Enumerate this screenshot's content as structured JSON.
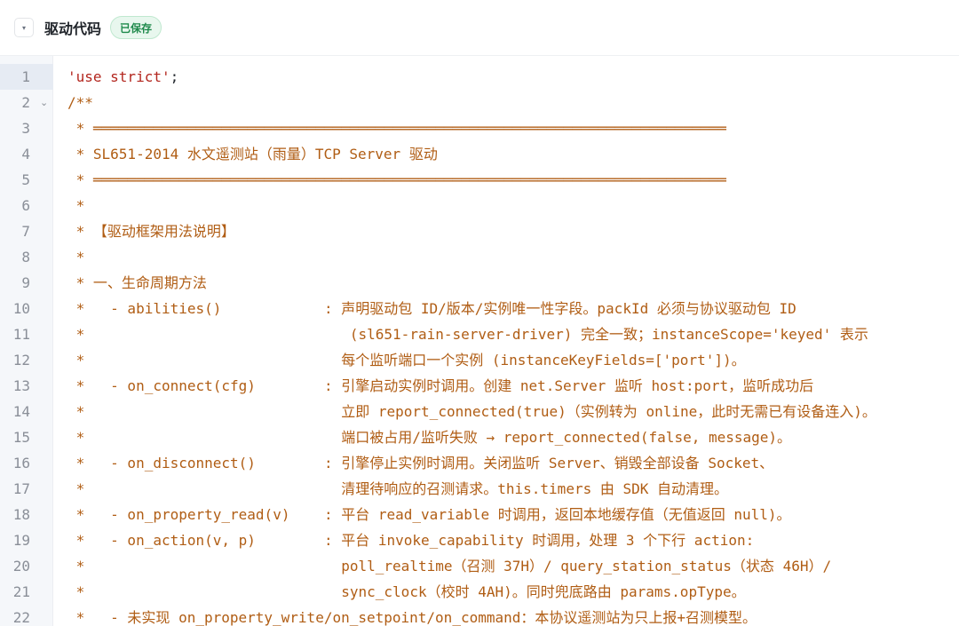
{
  "header": {
    "collapse_glyph": "▾",
    "title": "驱动代码",
    "status_badge": "已保存"
  },
  "colors": {
    "comment": "#b05d14",
    "string": "#b3261e",
    "line_number": "#8a8f98",
    "gutter_bg": "#f5f7fa",
    "active_line_bg": "#e6ebf3",
    "badge_bg": "#e8f7ee",
    "badge_text": "#1f8a4c"
  },
  "editor": {
    "active_line": 1,
    "fold_marker_line": 2,
    "fold_icon": "chevron-down-icon",
    "line1": {
      "string": "'use strict'",
      "punct": ";"
    },
    "lines": [
      {
        "num": "1",
        "text": ""
      },
      {
        "num": "2",
        "text": "/**"
      },
      {
        "num": "3",
        "text": " * ══════════════════════════════════════════════════════════════════════════"
      },
      {
        "num": "4",
        "text": " * SL651-2014 水文遥测站（雨量）TCP Server 驱动"
      },
      {
        "num": "5",
        "text": " * ══════════════════════════════════════════════════════════════════════════"
      },
      {
        "num": "6",
        "text": " *"
      },
      {
        "num": "7",
        "text": " * 【驱动框架用法说明】"
      },
      {
        "num": "8",
        "text": " *"
      },
      {
        "num": "9",
        "text": " * 一、生命周期方法"
      },
      {
        "num": "10",
        "text": " *   - abilities()            : 声明驱动包 ID/版本/实例唯一性字段。packId 必须与协议驱动包 ID"
      },
      {
        "num": "11",
        "text": " *                               (sl651-rain-server-driver) 完全一致；instanceScope='keyed' 表示"
      },
      {
        "num": "12",
        "text": " *                              每个监听端口一个实例 (instanceKeyFields=['port'])。"
      },
      {
        "num": "13",
        "text": " *   - on_connect(cfg)        : 引擎启动实例时调用。创建 net.Server 监听 host:port，监听成功后"
      },
      {
        "num": "14",
        "text": " *                              立即 report_connected(true)（实例转为 online，此时无需已有设备连入)。"
      },
      {
        "num": "15",
        "text": " *                              端口被占用/监听失败 → report_connected(false, message)。"
      },
      {
        "num": "16",
        "text": " *   - on_disconnect()        : 引擎停止实例时调用。关闭监听 Server、销毁全部设备 Socket、"
      },
      {
        "num": "17",
        "text": " *                              清理待响应的召测请求。this.timers 由 SDK 自动清理。"
      },
      {
        "num": "18",
        "text": " *   - on_property_read(v)    : 平台 read_variable 时调用，返回本地缓存值（无值返回 null)。"
      },
      {
        "num": "19",
        "text": " *   - on_action(v, p)        : 平台 invoke_capability 时调用，处理 3 个下行 action:"
      },
      {
        "num": "20",
        "text": " *                              poll_realtime（召测 37H）/ query_station_status（状态 46H）/"
      },
      {
        "num": "21",
        "text": " *                              sync_clock（校时 4AH)。同时兜底路由 params.opType。"
      },
      {
        "num": "22",
        "text": " *   - 未实现 on_property_write/on_setpoint/on_command：本协议遥测站为只上报+召测模型。"
      }
    ]
  }
}
